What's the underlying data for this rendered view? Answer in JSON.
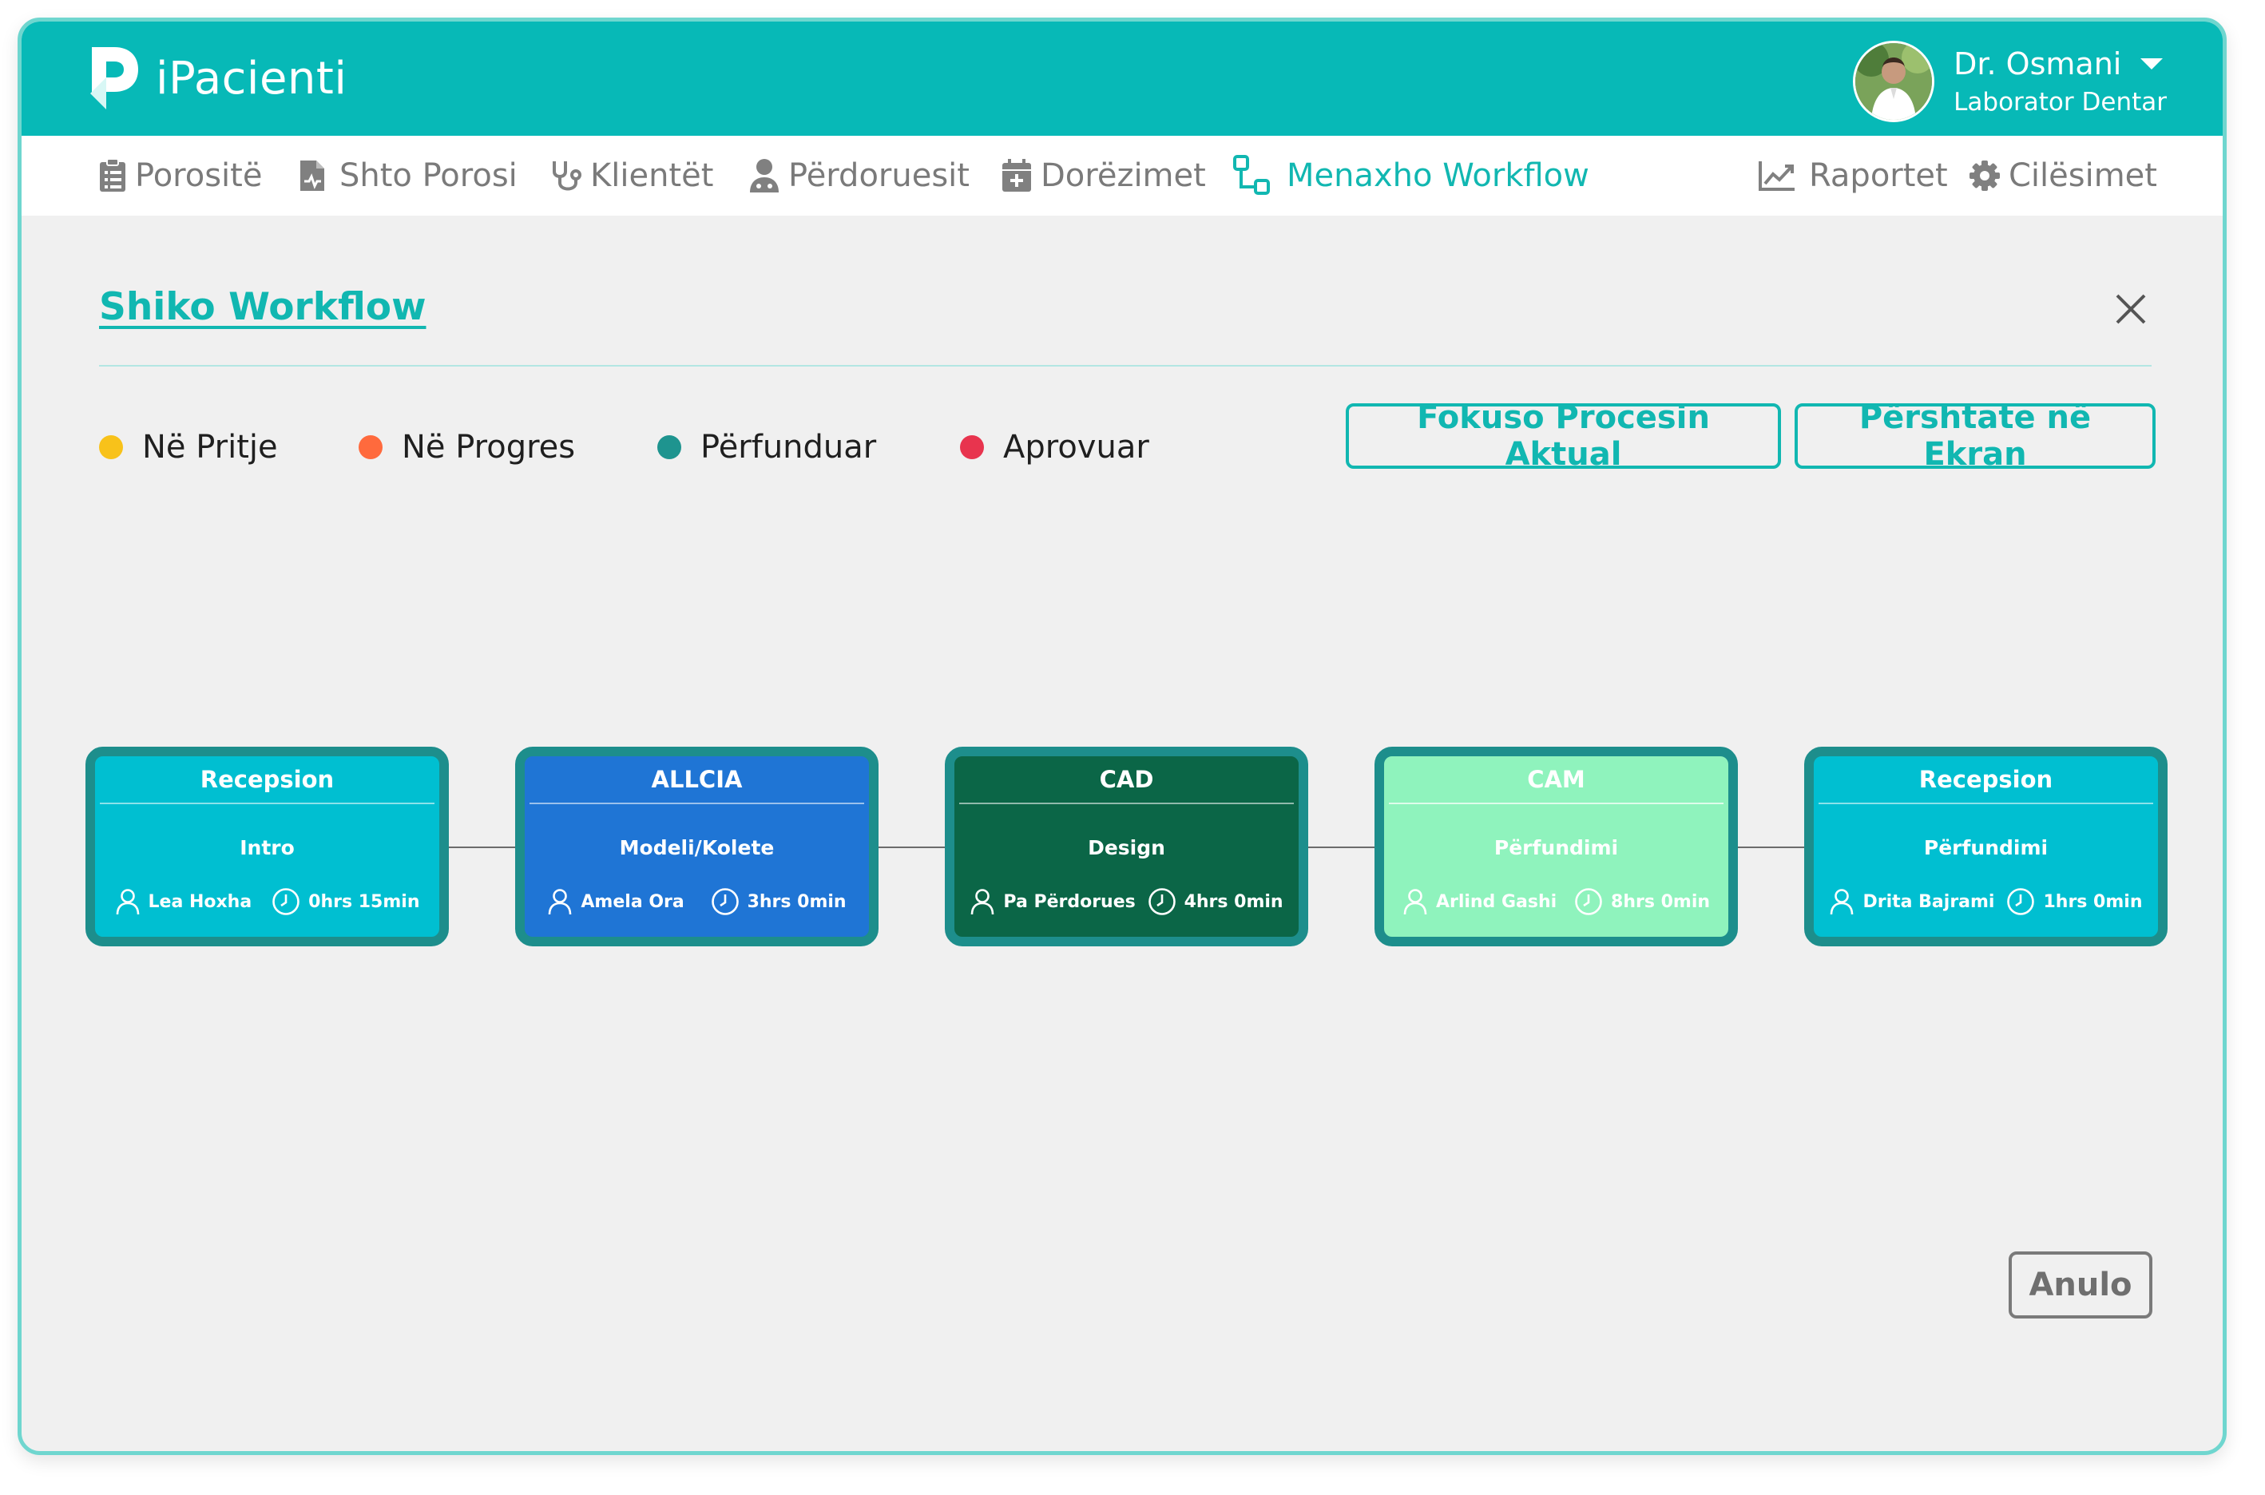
{
  "header": {
    "app_name": "iPacienti",
    "user": {
      "name": "Dr. Osmani",
      "role": "Laborator Dentar"
    }
  },
  "nav": {
    "items": [
      {
        "label": "Porositë",
        "icon": "clipboard-icon"
      },
      {
        "label": "Shto Porosi",
        "icon": "file-add-icon"
      },
      {
        "label": "Klientët",
        "icon": "stethoscope-icon"
      },
      {
        "label": "Përdoruesit",
        "icon": "user-doctor-icon"
      },
      {
        "label": "Dorëzimet",
        "icon": "calendar-plus-icon"
      },
      {
        "label": "Menaxho Workflow",
        "icon": "workflow-icon",
        "active": true
      }
    ],
    "right_items": [
      {
        "label": "Raportet",
        "icon": "chart-line-icon"
      },
      {
        "label": "Cilësimet",
        "icon": "gear-icon"
      }
    ]
  },
  "page": {
    "title": "Shiko Workflow",
    "legend": [
      {
        "label": "Në Pritje",
        "color": "#f8c21a"
      },
      {
        "label": "Në Progres",
        "color": "#ff6a3d"
      },
      {
        "label": "Përfunduar",
        "color": "#1e948f"
      },
      {
        "label": "Aprovuar",
        "color": "#e8344e"
      }
    ],
    "buttons": {
      "focus": "Fokuso Procesin Aktual",
      "fit": "Përshtate në Ekran",
      "cancel": "Anulo"
    }
  },
  "workflow": {
    "nodes": [
      {
        "department": "Recepsion",
        "step": "Intro",
        "user": "Lea Hoxha",
        "duration": "0hrs 15min",
        "bg": "#00bfd1",
        "text": "#ffffff"
      },
      {
        "department": "ALLCIA",
        "step": "Modeli/Kolete",
        "user": "Amela Ora",
        "duration": "3hrs 0min",
        "bg": "#1f75d5",
        "text": "#ffffff"
      },
      {
        "department": "CAD",
        "step": "Design",
        "user": "Pa Përdorues",
        "duration": "4hrs 0min",
        "bg": "#0b6647",
        "text": "#ffffff"
      },
      {
        "department": "CAM",
        "step": "Përfundimi",
        "user": "Arlind Gashi",
        "duration": "8hrs 0min",
        "bg": "#8ff3bd",
        "text": "#ffffff"
      },
      {
        "department": "Recepsion",
        "step": "Përfundimi",
        "user": "Drita Bajrami",
        "duration": "1hrs 0min",
        "bg": "#00bfd1",
        "text": "#ffffff"
      }
    ]
  }
}
